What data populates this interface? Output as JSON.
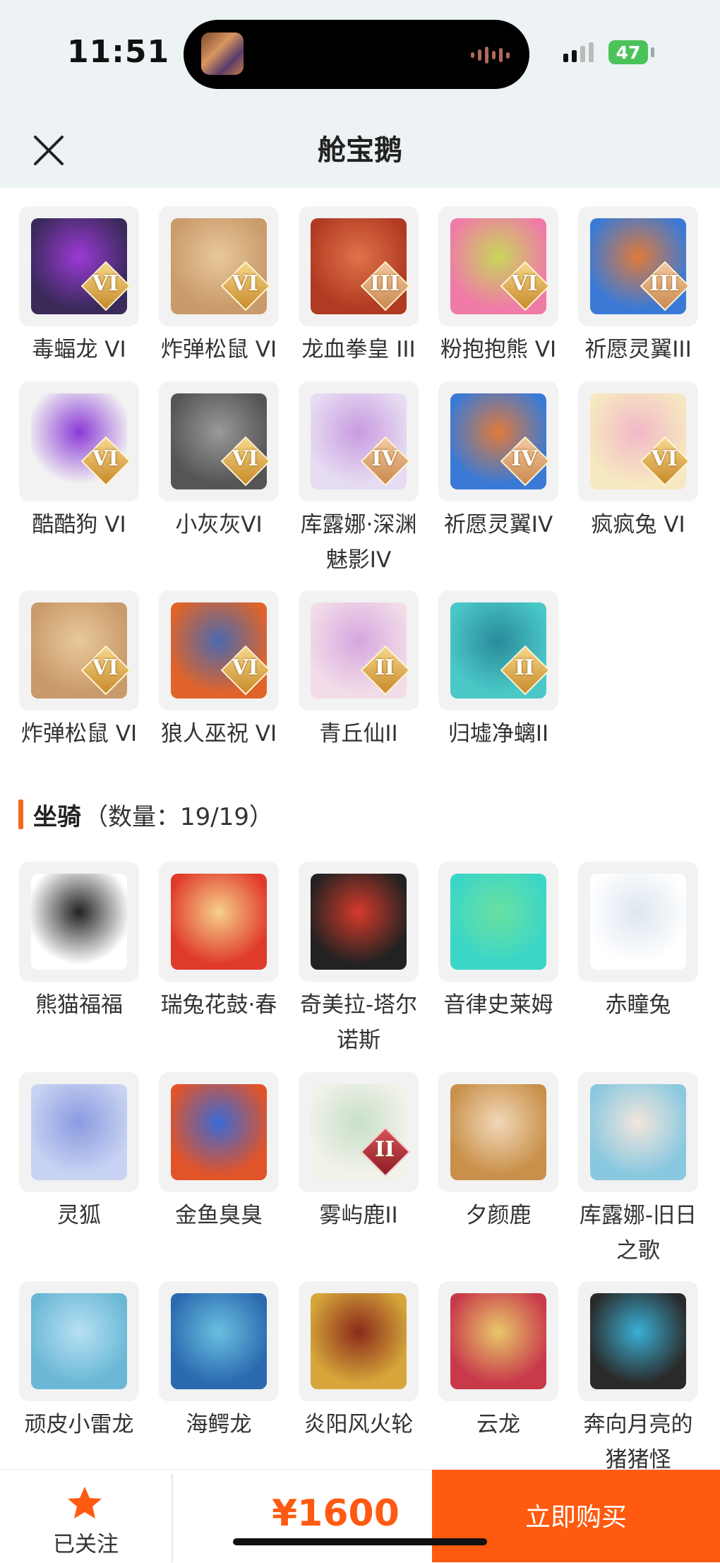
{
  "status_bar": {
    "time": "11:51",
    "battery": "47"
  },
  "header": {
    "title": "舱宝鹅"
  },
  "top_grid": {
    "rows": [
      [
        {
          "label": "毒蝠龙 VI",
          "badge": "VI",
          "badge_style": "gold",
          "color1": "#3a2a5a",
          "color2": "#9b3ad6"
        },
        {
          "label": "炸弹松鼠 VI",
          "badge": "VI",
          "badge_style": "gold",
          "color1": "#c99a6a",
          "color2": "#e8c89a"
        },
        {
          "label": "龙血拳皇 III",
          "badge": "III",
          "badge_style": "silver",
          "color1": "#b03a22",
          "color2": "#e0734a"
        },
        {
          "label": "粉抱抱熊 VI",
          "badge": "VI",
          "badge_style": "gold",
          "color1": "#f07aa8",
          "color2": "#c8d65a"
        },
        {
          "label": "祈愿灵翼III",
          "badge": "III",
          "badge_style": "silver",
          "color1": "#3a7ad6",
          "color2": "#e07a3a"
        }
      ],
      [
        {
          "label": "酷酷狗 VI",
          "badge": "VI",
          "badge_style": "gold",
          "color1": "#f2f2f2",
          "color2": "#8a3ad6"
        },
        {
          "label": "小灰灰VI",
          "badge": "VI",
          "badge_style": "gold",
          "color1": "#555555",
          "color2": "#999999"
        },
        {
          "label": "库露娜·深渊魅影IV",
          "badge": "IV",
          "badge_style": "silver",
          "color1": "#e6dcf2",
          "color2": "#c89ae0"
        },
        {
          "label": "祈愿灵翼IV",
          "badge": "IV",
          "badge_style": "silver",
          "color1": "#3a7ad6",
          "color2": "#e07a3a"
        },
        {
          "label": "疯疯兔 VI",
          "badge": "VI",
          "badge_style": "gold",
          "color1": "#f6e8c0",
          "color2": "#f2b8c8"
        }
      ],
      [
        {
          "label": "炸弹松鼠 VI",
          "badge": "VI",
          "badge_style": "gold",
          "color1": "#c99a6a",
          "color2": "#e8c89a"
        },
        {
          "label": "狼人巫祝 VI",
          "badge": "VI",
          "badge_style": "gold",
          "color1": "#e0642a",
          "color2": "#4a6ab0"
        },
        {
          "label": "青丘仙II",
          "badge": "II",
          "badge_style": "gold",
          "color1": "#f2dce8",
          "color2": "#d6a6e0"
        },
        {
          "label": "归墟净螭II",
          "badge": "II",
          "badge_style": "gold",
          "color1": "#4ac8c8",
          "color2": "#2a8a9a"
        }
      ]
    ]
  },
  "mounts_section": {
    "name": "坐骑",
    "count": "（数量：19/19）"
  },
  "mounts_grid": {
    "rows": [
      [
        {
          "label": "熊猫福福",
          "badge": "",
          "color1": "#ffffff",
          "color2": "#222222"
        },
        {
          "label": "瑞兔花鼓·春",
          "badge": "",
          "color1": "#e03a2a",
          "color2": "#f6d08a"
        },
        {
          "label": "奇美拉-塔尔诺斯",
          "badge": "",
          "color1": "#222222",
          "color2": "#d63a2a"
        },
        {
          "label": "音律史莱姆",
          "badge": "",
          "color1": "#3ad6c8",
          "color2": "#6ae0a0"
        },
        {
          "label": "赤瞳兔",
          "badge": "",
          "color1": "#ffffff",
          "color2": "#dde6f0"
        }
      ],
      [
        {
          "label": "灵狐",
          "badge": "",
          "color1": "#c8d2f2",
          "color2": "#8a9ae0"
        },
        {
          "label": "金鱼臭臭",
          "badge": "",
          "color1": "#e0542a",
          "color2": "#3a6ad6"
        },
        {
          "label": "雾屿鹿II",
          "badge": "II",
          "badge_style": "red",
          "color1": "#f2f2ea",
          "color2": "#c8e0c8"
        },
        {
          "label": "夕颜鹿",
          "badge": "",
          "color1": "#c8904a",
          "color2": "#f2d8b8"
        },
        {
          "label": "库露娜-旧日之歌",
          "badge": "",
          "color1": "#8ac8e0",
          "color2": "#f2e6dc"
        }
      ],
      [
        {
          "label": "顽皮小雷龙",
          "badge": "",
          "color1": "#6ab8d6",
          "color2": "#b8e0f2"
        },
        {
          "label": "海鳄龙",
          "badge": "",
          "color1": "#2a6ab0",
          "color2": "#6ac0e0"
        },
        {
          "label": "炎阳风火轮",
          "badge": "",
          "color1": "#d6a63a",
          "color2": "#8a2a1a"
        },
        {
          "label": "云龙",
          "badge": "",
          "color1": "#c83a4a",
          "color2": "#e8c86a"
        },
        {
          "label": "奔向月亮的猪猪怪",
          "badge": "",
          "color1": "#2a2a2a",
          "color2": "#3ab0d6"
        }
      ]
    ]
  },
  "bottom_bar": {
    "follow_label": "已关注",
    "price": "¥1600",
    "buy_label": "立即购买",
    "accent": "#fe5a10"
  }
}
